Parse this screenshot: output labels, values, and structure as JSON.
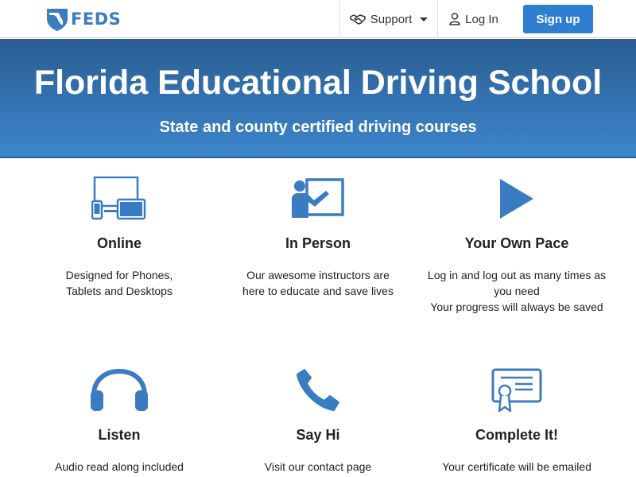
{
  "brand": {
    "name": "FEDS"
  },
  "nav": {
    "support": "Support",
    "login": "Log In",
    "signup": "Sign up"
  },
  "hero": {
    "title": "Florida Educational Driving School",
    "subtitle": "State and county certified driving courses"
  },
  "features": [
    {
      "icon": "devices-icon",
      "title": "Online",
      "desc": [
        "Designed for Phones,",
        "Tablets and Desktops"
      ]
    },
    {
      "icon": "instructor-icon",
      "title": "In Person",
      "desc": [
        "Our awesome instructors are",
        "here to educate and save lives"
      ]
    },
    {
      "icon": "play-icon",
      "title": "Your Own Pace",
      "desc": [
        "Log in and log out as many times as",
        "you need",
        "Your progress will always be saved"
      ]
    },
    {
      "icon": "headphones-icon",
      "title": "Listen",
      "desc": [
        "Audio read along included"
      ]
    },
    {
      "icon": "phone-icon",
      "title": "Say Hi",
      "desc": [
        "Visit our contact page"
      ]
    },
    {
      "icon": "certificate-icon",
      "title": "Complete It!",
      "desc": [
        "Your certificate will be emailed"
      ]
    }
  ],
  "colors": {
    "accent": "#3a7cc2",
    "button": "#2e7fd2",
    "hero_top": "#2a5d91",
    "hero_bottom": "#3d86cc"
  }
}
